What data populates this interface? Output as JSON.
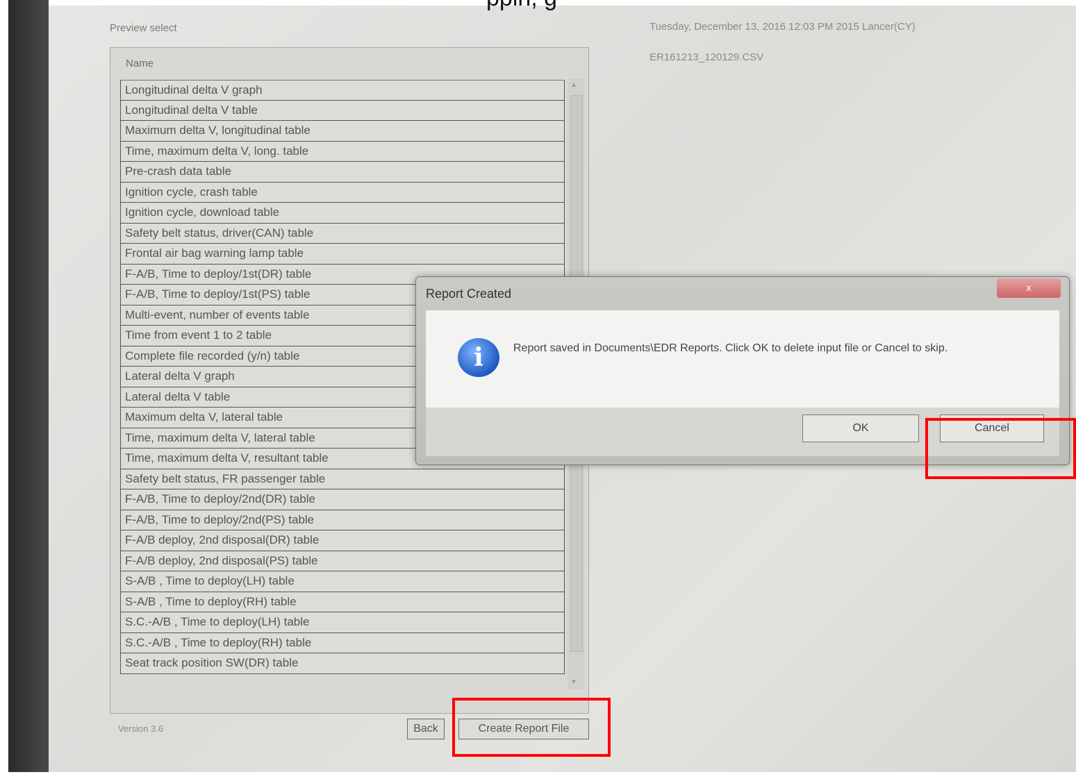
{
  "overlay_text": "ppin, g",
  "app": {
    "title": "Preview select",
    "datetime": "Tuesday, December 13, 2016 12:03 PM    2015 Lancer(CY)",
    "filename": "ER161213_120129.CSV",
    "version": "Version 3.6"
  },
  "list": {
    "header": "Name",
    "items": [
      "Longitudinal delta V graph",
      "Longitudinal delta V table",
      "Maximum delta V, longitudinal table",
      "Time, maximum delta V, long. table",
      "Pre-crash data table",
      "Ignition cycle, crash table",
      "Ignition cycle, download table",
      "Safety belt status, driver(CAN) table",
      "Frontal air bag warning lamp table",
      "F-A/B, Time to deploy/1st(DR) table",
      "F-A/B, Time to deploy/1st(PS) table",
      "Multi-event, number of events table",
      "Time from event 1 to 2 table",
      "Complete file recorded (y/n) table",
      "Lateral delta V graph",
      "Lateral delta V table",
      "Maximum delta V, lateral table",
      "Time, maximum delta V, lateral table",
      "Time, maximum delta V, resultant table",
      "Safety belt status, FR passenger table",
      "F-A/B, Time to deploy/2nd(DR) table",
      "F-A/B, Time to deploy/2nd(PS) table",
      "F-A/B deploy, 2nd disposal(DR) table",
      "F-A/B deploy, 2nd disposal(PS) table",
      "S-A/B , Time to deploy(LH) table",
      "S-A/B , Time to deploy(RH) table",
      "S.C.-A/B , Time to deploy(LH) table",
      "S.C.-A/B , Time to deploy(RH) table",
      "Seat track position SW(DR) table"
    ]
  },
  "buttons": {
    "back": "Back",
    "create": "Create Report File"
  },
  "dialog": {
    "title": "Report Created",
    "close": "x",
    "icon_glyph": "i",
    "message": "Report saved in Documents\\EDR Reports. Click OK to delete input file or Cancel to skip.",
    "ok": "OK",
    "cancel": "Cancel"
  },
  "colors": {
    "highlight": "#ff0000"
  }
}
